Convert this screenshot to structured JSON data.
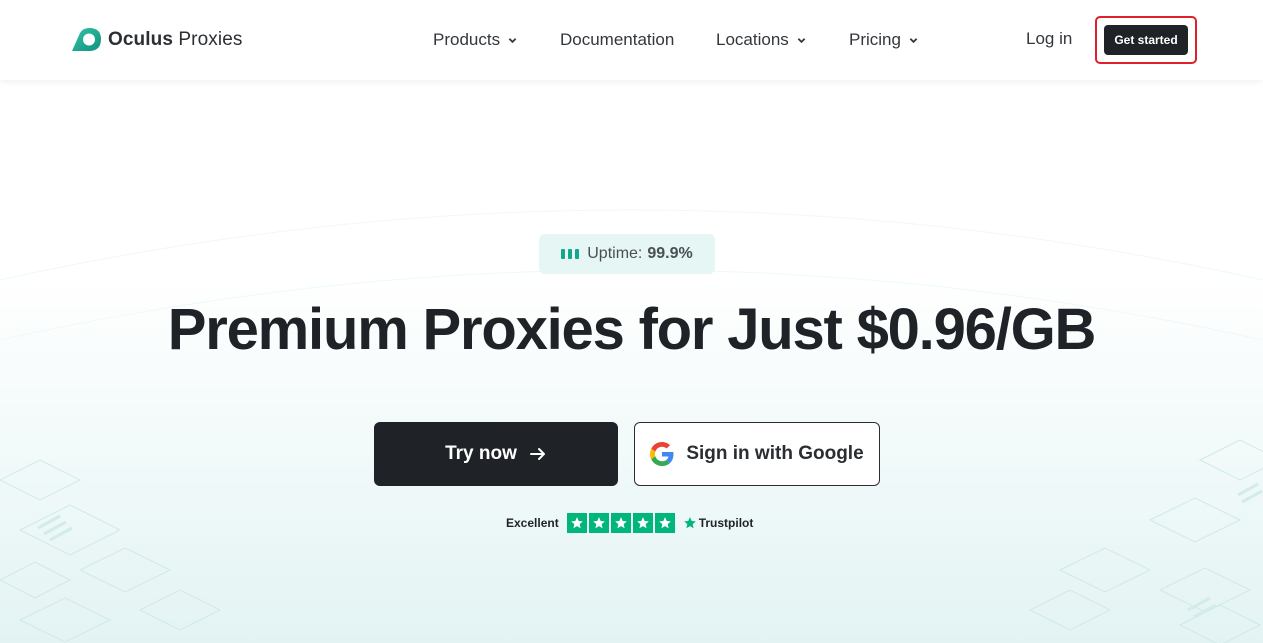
{
  "brand": {
    "name_bold": "Oculus",
    "name_regular": "Proxies",
    "logo_icon": "oculus-logo-icon",
    "accent": "#15a78e"
  },
  "nav": {
    "items": [
      {
        "label": "Products",
        "has_dropdown": true
      },
      {
        "label": "Documentation",
        "has_dropdown": false
      },
      {
        "label": "Locations",
        "has_dropdown": true
      },
      {
        "label": "Pricing",
        "has_dropdown": true
      }
    ],
    "login_label": "Log in",
    "cta_label": "Get started",
    "cta_highlight_color": "#e0202a"
  },
  "hero": {
    "uptime_label": "Uptime:",
    "uptime_value": "99.9%",
    "headline": "Premium Proxies for Just $0.96/GB",
    "primary_button": "Try now",
    "secondary_button": "Sign in with Google",
    "rating_label": "Excellent",
    "rating_stars": 5,
    "rating_source": "Trustpilot",
    "trustpilot_color": "#00b67a"
  }
}
